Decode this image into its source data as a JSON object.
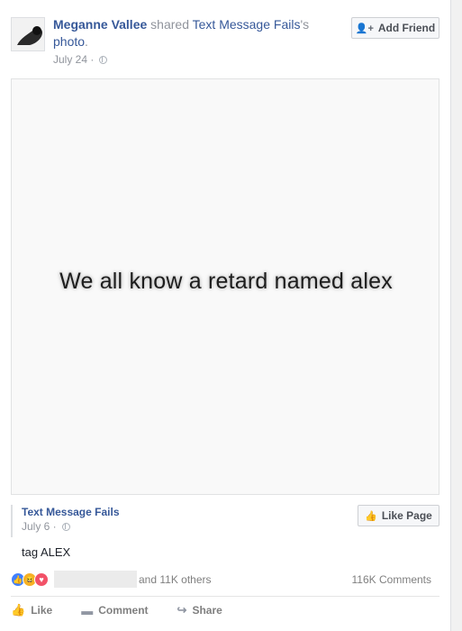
{
  "post": {
    "author": "Meganne Vallee",
    "shared_word": " shared ",
    "page_name": "Text Message Fails",
    "possessive": "'s",
    "object": "photo",
    "period": ".",
    "date": "July 24 ·",
    "add_friend": "Add Friend"
  },
  "photo": {
    "text": "We all know a retard named alex"
  },
  "source": {
    "page_name": "Text Message Fails",
    "date": "July 6 ·",
    "like_page": "Like Page",
    "caption": "tag ALEX"
  },
  "engagement": {
    "reactions": [
      "like-icon",
      "haha-icon",
      "love-icon"
    ],
    "others": "and 11K others",
    "comments": "116K Comments"
  },
  "actions": {
    "like": "Like",
    "comment": "Comment",
    "share": "Share"
  }
}
